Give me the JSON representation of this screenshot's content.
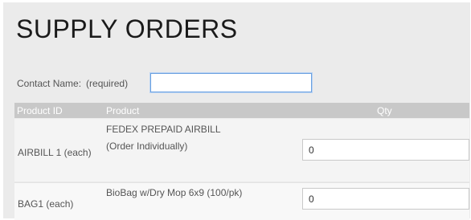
{
  "page": {
    "title": "SUPPLY ORDERS"
  },
  "contact": {
    "label": "Contact Name:",
    "required": "(required)",
    "value": ""
  },
  "table": {
    "headers": {
      "product_id": "Product ID",
      "product": "Product",
      "qty": "Qty"
    },
    "rows": [
      {
        "product_id": "AIRBILL 1 (each)",
        "product": "FEDEX PREPAID AIRBILL (Order Individually)",
        "qty": "0"
      },
      {
        "product_id": "BAG1 (each)",
        "product": "BioBag w/Dry Mop 6x9 (100/pk)",
        "qty": "0"
      }
    ]
  }
}
